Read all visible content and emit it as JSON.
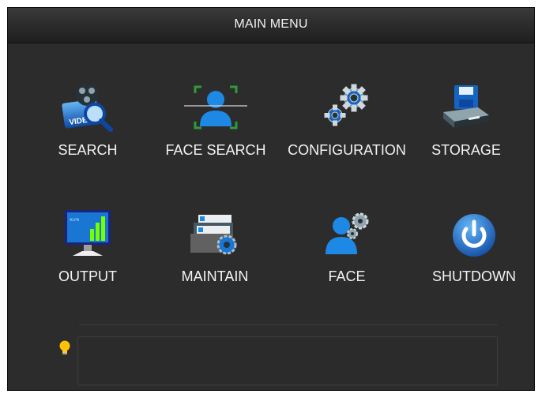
{
  "window": {
    "title": "MAIN MENU"
  },
  "menu": {
    "items": [
      {
        "label": "SEARCH",
        "icon": "video-search-icon"
      },
      {
        "label": "FACE SEARCH",
        "icon": "face-scan-icon"
      },
      {
        "label": "CONFIGURATION",
        "icon": "gears-icon"
      },
      {
        "label": "STORAGE",
        "icon": "storage-drive-icon"
      },
      {
        "label": "OUTPUT",
        "icon": "monitor-icon"
      },
      {
        "label": "MAINTAIN",
        "icon": "maintain-folder-gear-icon"
      },
      {
        "label": "FACE",
        "icon": "face-gear-icon"
      },
      {
        "label": "SHUTDOWN",
        "icon": "power-icon"
      }
    ]
  },
  "hint": {
    "icon": "lightbulb-icon",
    "text": ""
  },
  "colors": {
    "background": "#2c2c2c",
    "accent_blue": "#1e88e5",
    "face_green": "#2e9b3a"
  }
}
